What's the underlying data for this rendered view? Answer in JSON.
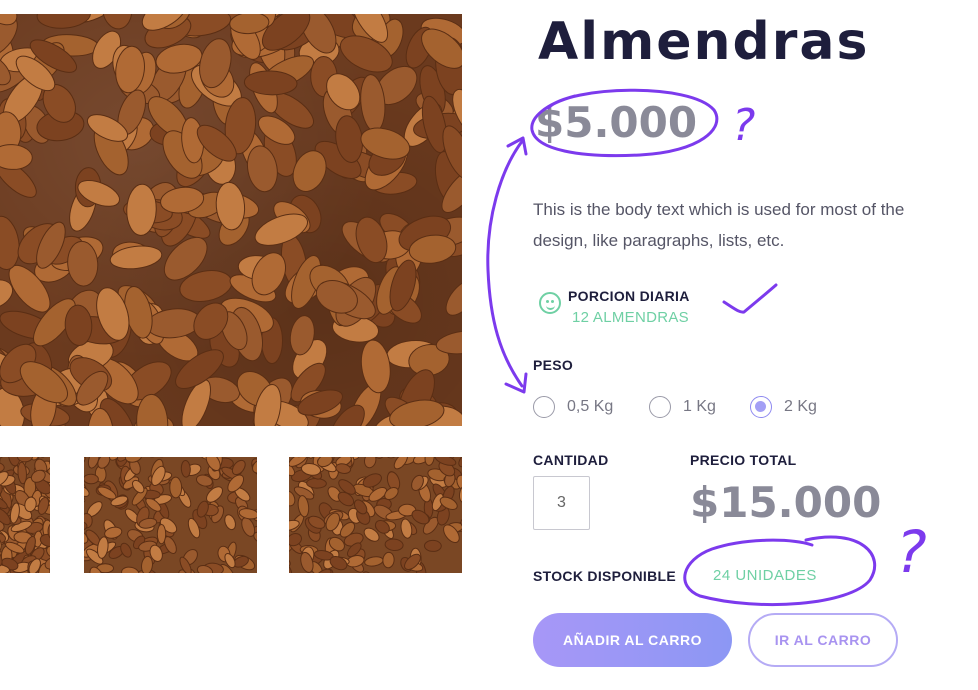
{
  "product": {
    "title": "Almendras",
    "price": "$5.000",
    "description": "This is the body text which is used for most of the design, like paragraphs, lists, etc."
  },
  "portion": {
    "title": "PORCION DIARIA",
    "value": "12 ALMENDRAS",
    "icon": "smiley-icon"
  },
  "weight": {
    "label": "PESO",
    "options": [
      "0,5 Kg",
      "1 Kg",
      "2 Kg"
    ],
    "selected": "2 Kg"
  },
  "quantity": {
    "label": "CANTIDAD",
    "value": "3"
  },
  "total": {
    "label": "PRECIO TOTAL",
    "value": "$15.000"
  },
  "stock": {
    "label": "STOCK DISPONIBLE",
    "value": "24 UNIDADES"
  },
  "buttons": {
    "add_to_cart": "AÑADIR AL CARRO",
    "go_to_cart": "IR AL CARRO"
  },
  "annotations": {
    "question_mark": "?"
  },
  "colors": {
    "accent": "#a39ff5",
    "success": "#6fd0a4",
    "annotation": "#7c3aed",
    "heading": "#1e1e3c"
  }
}
